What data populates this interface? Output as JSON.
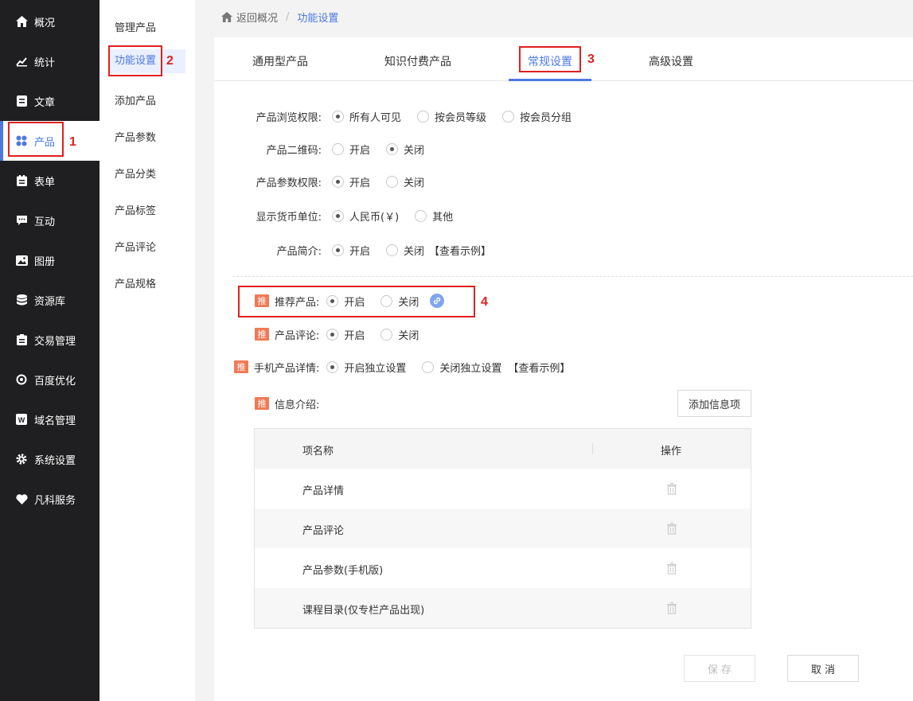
{
  "nav": {
    "items": [
      {
        "label": "概况",
        "icon": "home-icon"
      },
      {
        "label": "统计",
        "icon": "chart-icon"
      },
      {
        "label": "文章",
        "icon": "article-icon"
      },
      {
        "label": "产品",
        "icon": "product-grid-icon"
      },
      {
        "label": "表单",
        "icon": "form-icon"
      },
      {
        "label": "互动",
        "icon": "chat-icon"
      },
      {
        "label": "图册",
        "icon": "gallery-icon"
      },
      {
        "label": "资源库",
        "icon": "database-icon"
      },
      {
        "label": "交易管理",
        "icon": "clipboard-icon"
      },
      {
        "label": "百度优化",
        "icon": "seo-icon"
      },
      {
        "label": "域名管理",
        "icon": "domain-icon"
      },
      {
        "label": "系统设置",
        "icon": "gear-icon"
      },
      {
        "label": "凡科服务",
        "icon": "heart-icon"
      }
    ],
    "active_index": 3
  },
  "subnav": {
    "items": [
      "管理产品",
      "功能设置",
      "添加产品",
      "产品参数",
      "产品分类",
      "产品标签",
      "产品评论",
      "产品规格"
    ],
    "active_index": 1
  },
  "breadcrumb": {
    "back": "返回概况",
    "separator": "/",
    "current": "功能设置"
  },
  "tabs": {
    "items": [
      "通用型产品",
      "知识付费产品",
      "常规设置",
      "高级设置"
    ],
    "active_index": 2
  },
  "settings": {
    "browse": {
      "label": "产品浏览权限:",
      "options": [
        "所有人可见",
        "按会员等级",
        "按会员分组"
      ],
      "selected": 0
    },
    "qrcode": {
      "label": "产品二维码:",
      "options": [
        "开启",
        "关闭"
      ],
      "selected": 1
    },
    "param_perm": {
      "label": "产品参数权限:",
      "options": [
        "开启",
        "关闭"
      ],
      "selected": 0
    },
    "currency": {
      "label": "显示货币单位:",
      "options": [
        "人民币(￥)",
        "其他"
      ],
      "selected": 0
    },
    "intro": {
      "label": "产品简介:",
      "options": [
        "开启",
        "关闭"
      ],
      "selected": 0,
      "example": "【查看示例】"
    },
    "recommend": {
      "badge": "推",
      "label": "推荐产品:",
      "options": [
        "开启",
        "关闭"
      ],
      "selected": 0
    },
    "review": {
      "badge": "推",
      "label": "产品评论:",
      "options": [
        "开启",
        "关闭"
      ],
      "selected": 0
    },
    "mobile_detail": {
      "badge": "推",
      "label": "手机产品详情:",
      "options": [
        "开启独立设置",
        "关闭独立设置"
      ],
      "selected": 0,
      "example": "【查看示例】"
    },
    "info": {
      "badge": "推",
      "label": "信息介绍:",
      "add_button": "添加信息项"
    }
  },
  "table": {
    "headers": [
      "项名称",
      "操作"
    ],
    "rows": [
      "产品详情",
      "产品评论",
      "产品参数(手机版)",
      "课程目录(仅专栏产品出现)"
    ]
  },
  "footer": {
    "save": "保 存",
    "cancel": "取 消"
  },
  "annotations": [
    "1",
    "2",
    "3",
    "4"
  ],
  "colors": {
    "accent": "#4c79e0",
    "badge": "#f07a55",
    "annotation": "#e02020",
    "nav_bg": "#1f1f21"
  }
}
